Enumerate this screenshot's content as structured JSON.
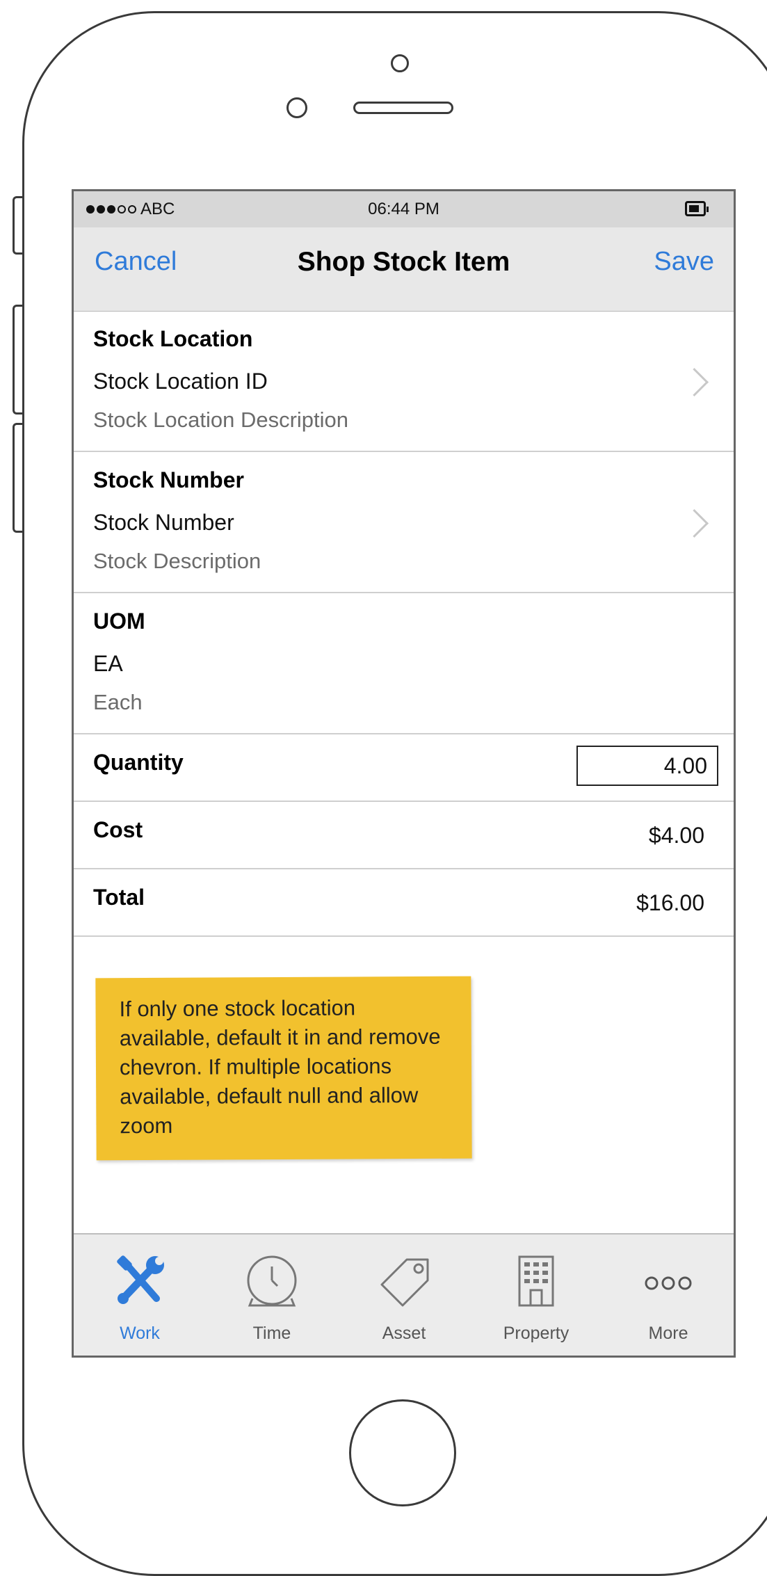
{
  "status_bar": {
    "carrier": "ABC",
    "time": "06:44 PM"
  },
  "nav": {
    "cancel": "Cancel",
    "title": "Shop Stock Item",
    "save": "Save"
  },
  "stock_location": {
    "title": "Stock Location",
    "value": "Stock Location ID",
    "description": "Stock Location Description"
  },
  "stock_number": {
    "title": "Stock Number",
    "value": "Stock Number",
    "description": "Stock Description"
  },
  "uom": {
    "title": "UOM",
    "value": "EA",
    "description": "Each"
  },
  "quantity": {
    "label": "Quantity",
    "value": "4.00"
  },
  "cost": {
    "label": "Cost",
    "value": "$4.00"
  },
  "total": {
    "label": "Total",
    "value": "$16.00"
  },
  "note": "If only one stock location available, default it in and remove chevron.  If multiple locations available, default null and allow zoom",
  "tabs": [
    {
      "label": "Work",
      "icon": "wrench-screwdriver-icon",
      "active": true
    },
    {
      "label": "Time",
      "icon": "clock-icon",
      "active": false
    },
    {
      "label": "Asset",
      "icon": "tag-icon",
      "active": false
    },
    {
      "label": "Property",
      "icon": "building-icon",
      "active": false
    },
    {
      "label": "More",
      "icon": "more-dots-icon",
      "active": false
    }
  ],
  "colors": {
    "accent": "#2f7bd9",
    "note_background": "#f2c12e"
  }
}
